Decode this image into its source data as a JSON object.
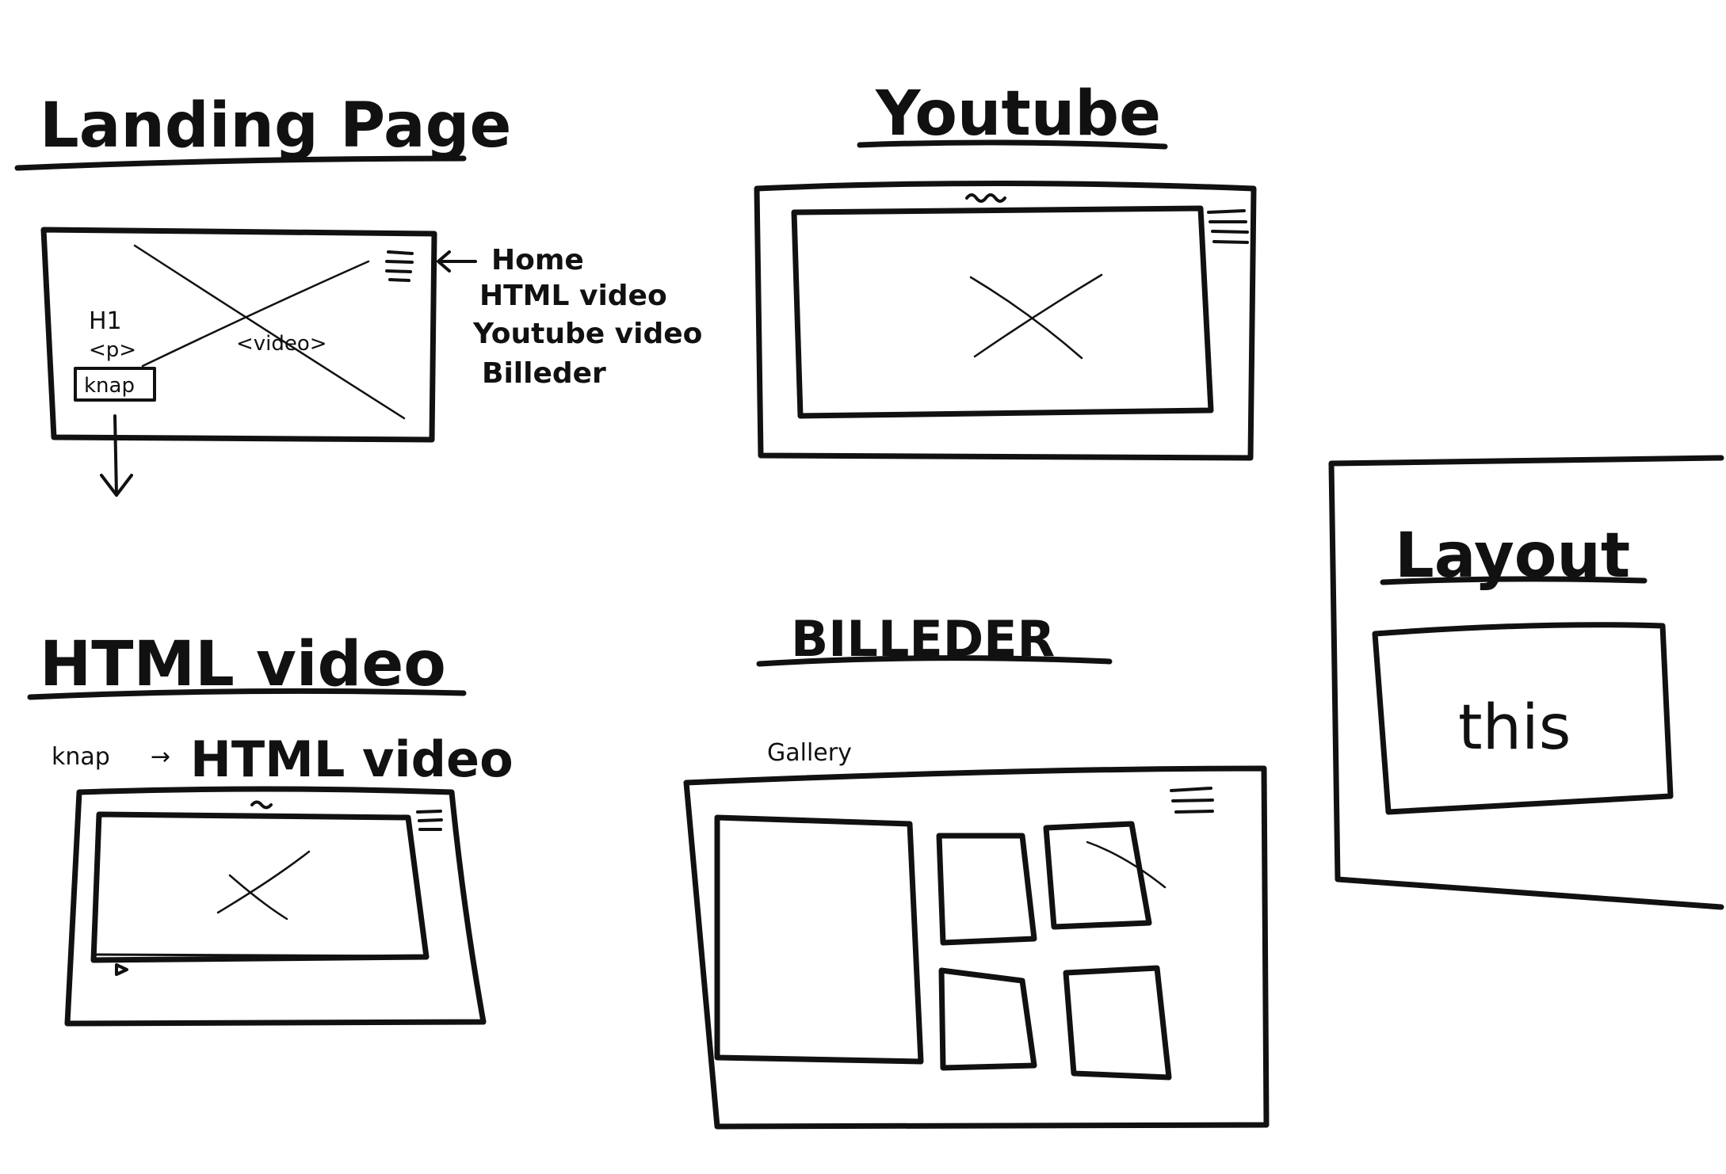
{
  "landing": {
    "title": "Landing Page",
    "h1": "H1",
    "p": "<p>",
    "video": "<video>",
    "button": "knap",
    "menu": [
      "Home",
      "HTML video",
      "Youtube video",
      "Billeder"
    ]
  },
  "youtube": {
    "title": "Youtube"
  },
  "html_video": {
    "title": "HTML video",
    "caption_left": "knap",
    "caption_arrow": "→",
    "caption_right": "HTML video"
  },
  "billeder": {
    "title": "BILLEDER",
    "subtitle": "Gallery"
  },
  "layout": {
    "title": "Layout",
    "box_text": "this"
  }
}
